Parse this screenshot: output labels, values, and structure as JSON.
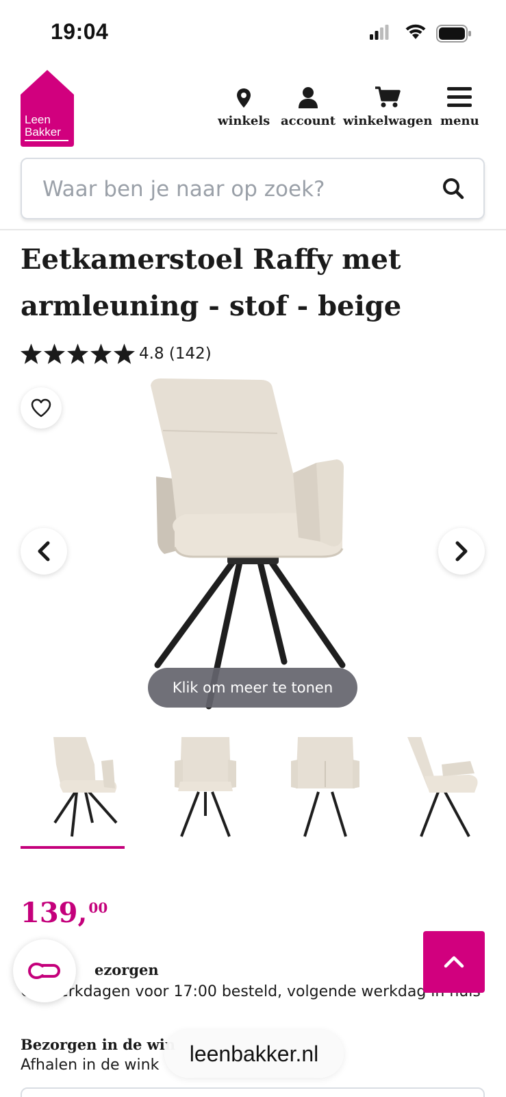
{
  "status_bar": {
    "time": "19:04"
  },
  "logo": {
    "line1": "Leen",
    "line2": "Bakker",
    "color": "#d1007e"
  },
  "nav": {
    "stores_label": "winkels",
    "account_label": "account",
    "cart_label": "winkelwagen",
    "menu_label": "menu"
  },
  "search": {
    "placeholder": "Waar ben je naar op zoek?"
  },
  "product": {
    "title": "Eetkamerstoel Raffy met armleuning - stof - beige",
    "rating_value": 4.8,
    "rating_text": "4.8 (142)",
    "stars_filled": 5
  },
  "gallery": {
    "more_label": "Klik om meer te tonen",
    "thumbnail_views": [
      "front-angle",
      "front",
      "back",
      "side"
    ],
    "active_thumbnail": 0
  },
  "price": {
    "whole": "139,",
    "cents": "00"
  },
  "delivery": {
    "title": "Thuisbezorgen",
    "title_visible": "ezorgen",
    "text": "Op werkdagen voor 17:00 besteld, volgende werkdag in huis"
  },
  "pickup": {
    "title": "Bezorgen in de win",
    "text": "Afhalen in de wink"
  },
  "browser": {
    "url": "leenbakker.nl"
  },
  "colors": {
    "accent": "#c4007b",
    "brand": "#d1007e"
  }
}
